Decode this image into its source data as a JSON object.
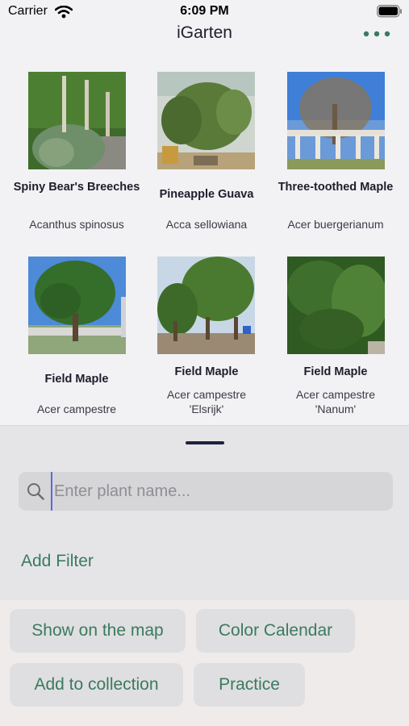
{
  "status_bar": {
    "carrier": "Carrier",
    "time": "6:09 PM"
  },
  "nav": {
    "title": "iGarten",
    "more_icon": "ellipsis-icon"
  },
  "plants": [
    {
      "common": "Spiny Bear's Breeches",
      "latin": "Acanthus spinosus"
    },
    {
      "common": "Pineapple Guava",
      "latin": "Acca sellowiana"
    },
    {
      "common": "Three-toothed Maple",
      "latin": "Acer buergerianum"
    },
    {
      "common": "Field Maple",
      "latin": "Acer campestre"
    },
    {
      "common": "Field Maple",
      "latin": "Acer campestre\n'Elsrijk'"
    },
    {
      "common": "Field Maple",
      "latin": "Acer campestre\n'Nanum'"
    }
  ],
  "search": {
    "placeholder": "Enter plant name..."
  },
  "filter": {
    "add_label": "Add Filter"
  },
  "actions": {
    "show_map": "Show on the map",
    "color_calendar": "Color Calendar",
    "add_collection": "Add to collection",
    "practice": "Practice"
  },
  "colors": {
    "accent": "#3b7a5e",
    "title": "#1d1d2e"
  }
}
